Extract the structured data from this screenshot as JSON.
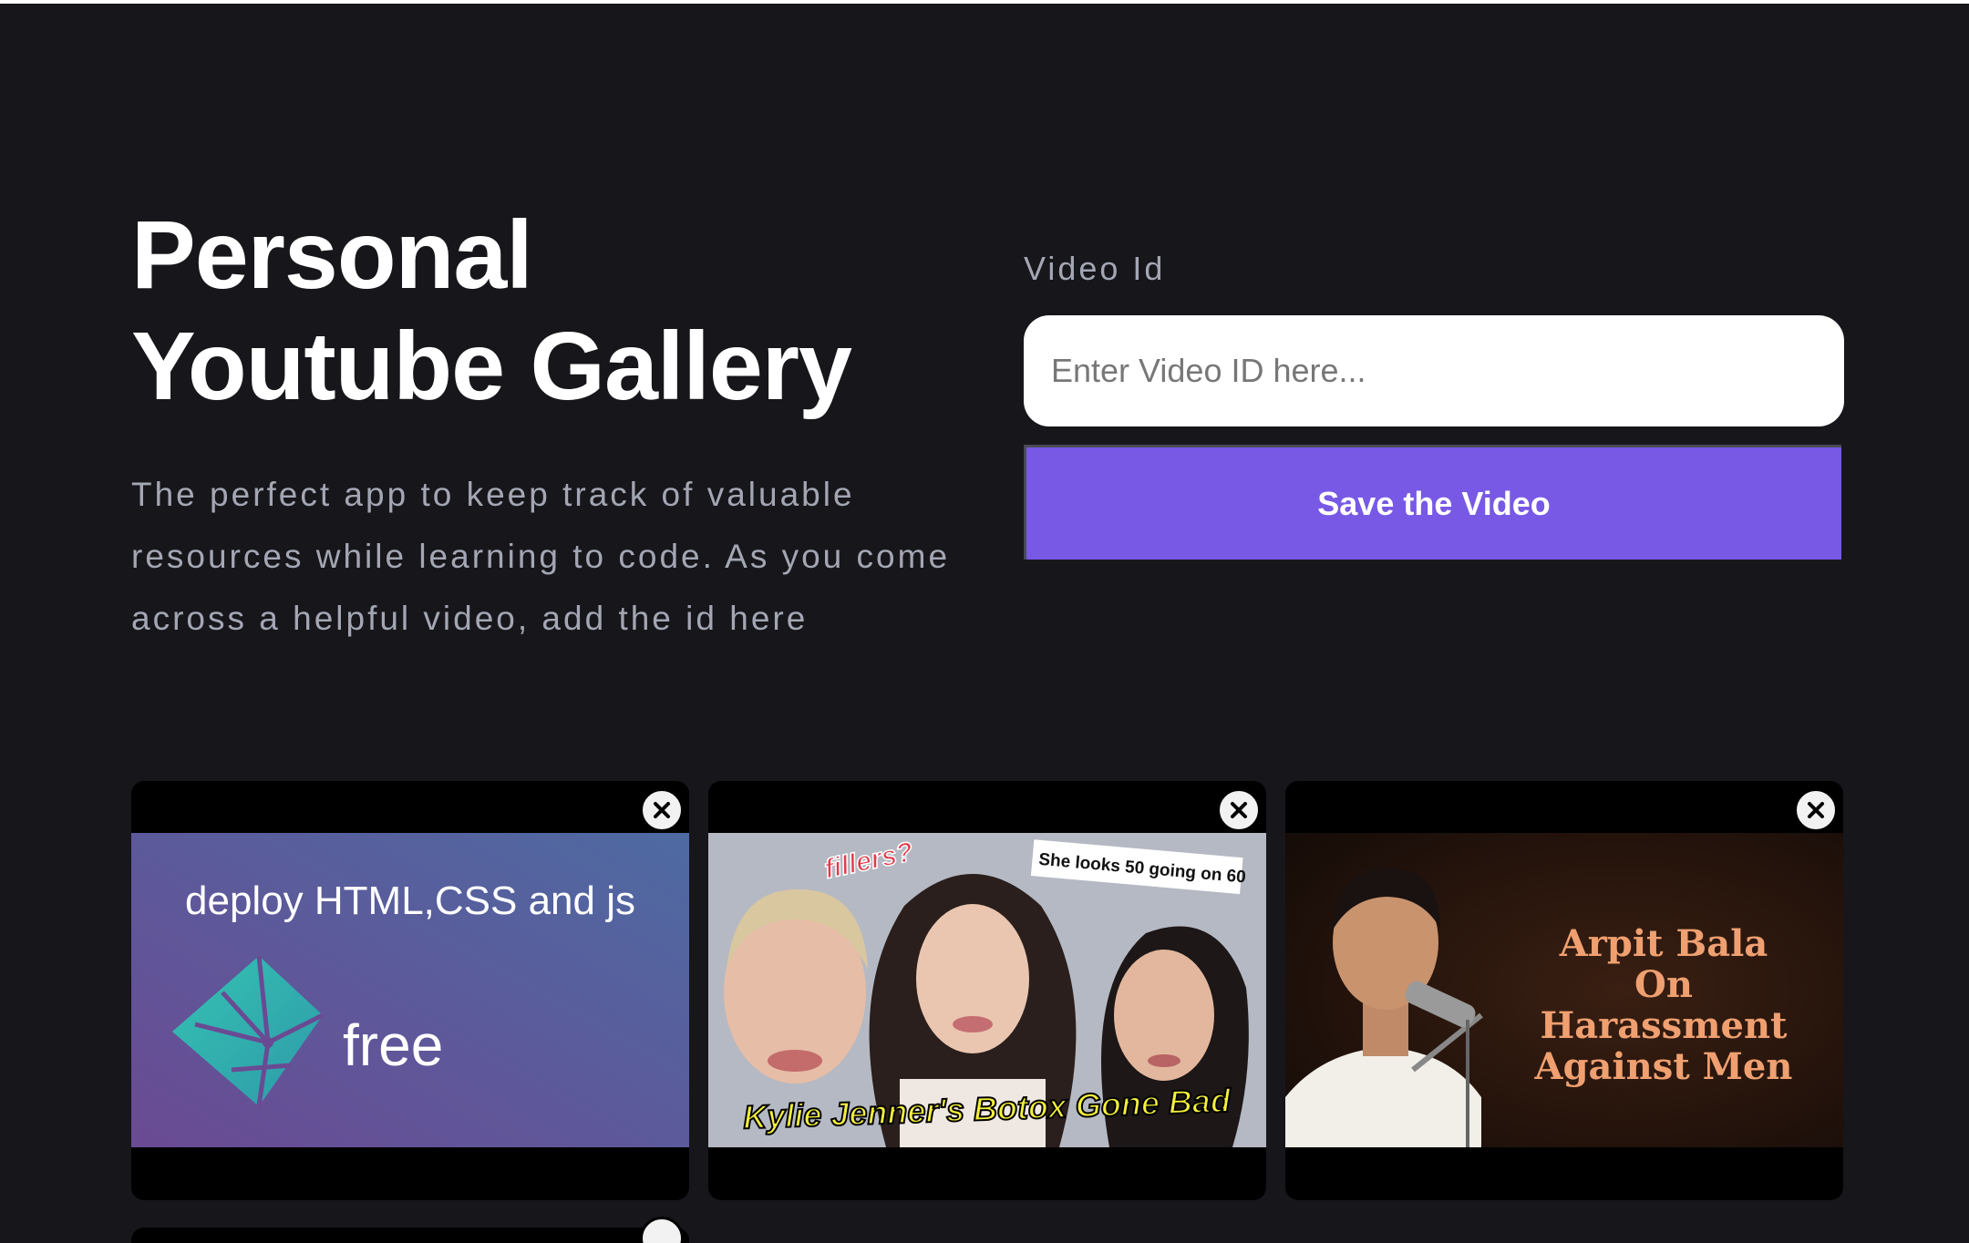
{
  "hero": {
    "title_line1": "Personal",
    "title_line2": "Youtube Gallery",
    "subtitle": "The perfect app to keep track of valuable resources while learning to code. As you come across a helpful video, add the id here"
  },
  "form": {
    "label": "Video Id",
    "input_value": "",
    "input_placeholder": "Enter Video ID here...",
    "save_label": "Save the Video"
  },
  "videos": [
    {
      "thumb_text_top": "deploy HTML,CSS and js",
      "thumb_text_bottom": "free",
      "icon": "netlify-logo-icon"
    },
    {
      "thumb_tag": "fillers?",
      "thumb_note": "She looks 50 going on 60",
      "thumb_caption": "Kylie Jenner's Botox Gone Bad"
    },
    {
      "thumb_lines": [
        "Arpit Bala",
        "On",
        "Harassment",
        "Against Men"
      ]
    }
  ],
  "colors": {
    "background": "#17161b",
    "accent": "#7759e5",
    "muted_text": "#a3a7b3"
  }
}
